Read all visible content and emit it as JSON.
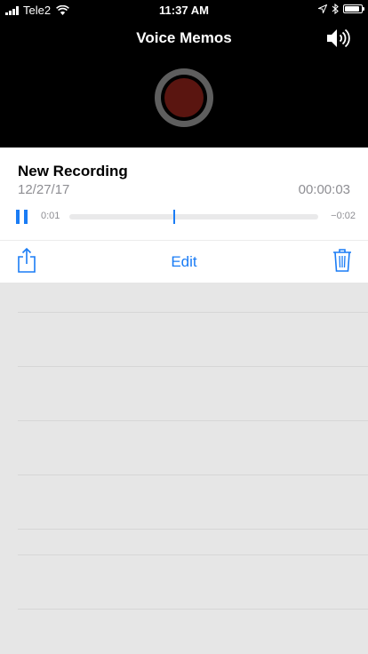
{
  "status_bar": {
    "carrier": "Tele2",
    "time": "11:37 AM",
    "battery_level": 0.9
  },
  "header": {
    "title": "Voice Memos"
  },
  "recording": {
    "name": "New Recording",
    "date": "12/27/17",
    "duration": "00:00:03",
    "elapsed": "0:01",
    "remaining": "−0:02",
    "playhead_fraction": 0.42
  },
  "actions": {
    "edit_label": "Edit"
  },
  "colors": {
    "accent": "#1a7cf5",
    "record_red": "#5a1510",
    "background": "#e6e6e6"
  }
}
